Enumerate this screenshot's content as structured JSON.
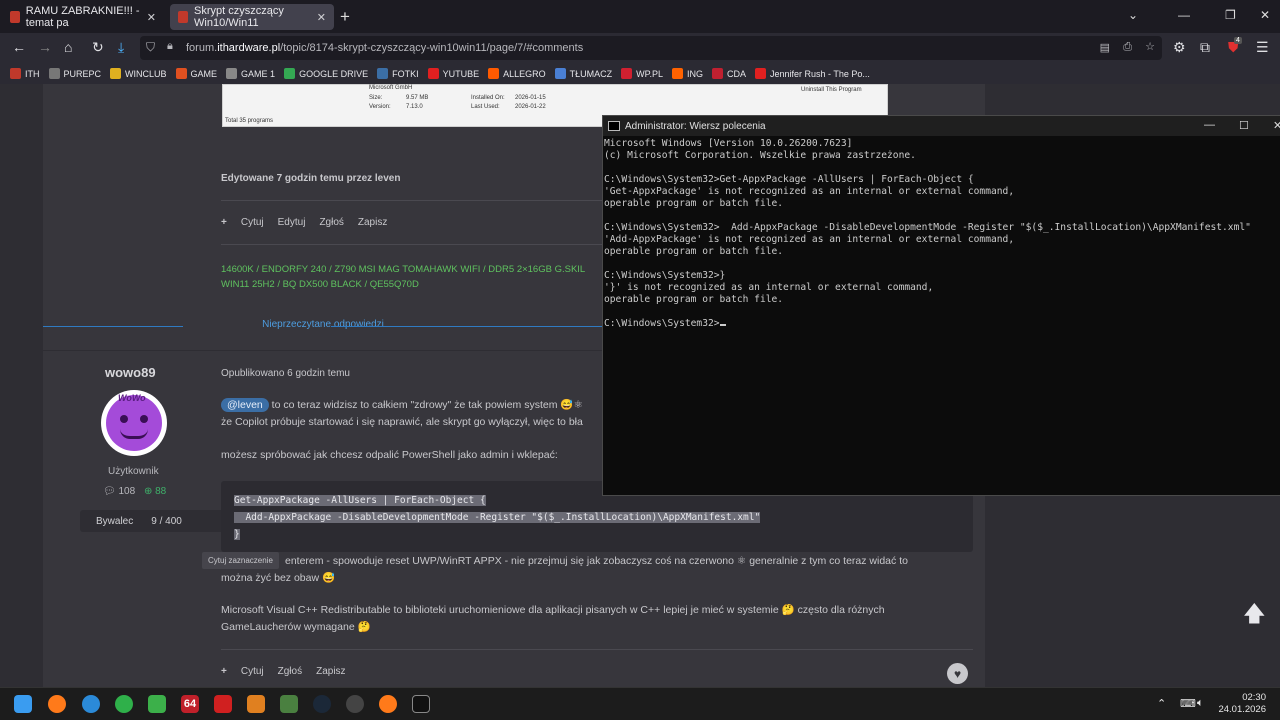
{
  "browser": {
    "tabs": [
      {
        "title": "RAMU ZABRAKNIE!!! - temat pa",
        "active": false
      },
      {
        "title": "Skrypt czyszczący Win10/Win11",
        "active": true
      }
    ],
    "url_prefix": "forum.",
    "url_domain": "ithardware.pl",
    "url_path": "/topic/8174-skrypt-czyszczący-win10win11/page/7/#comments",
    "bookmarks": [
      {
        "label": "ITH",
        "color": "#c0392b"
      },
      {
        "label": "PUREPC",
        "color": "#777777"
      },
      {
        "label": "WINCLUB",
        "color": "#e0b020"
      },
      {
        "label": "GAME",
        "color": "#e05020"
      },
      {
        "label": "GAME 1",
        "color": "#888888"
      },
      {
        "label": "GOOGLE DRIVE",
        "color": "#34a853"
      },
      {
        "label": "FOTKI",
        "color": "#3b6ea5"
      },
      {
        "label": "YUTUBE",
        "color": "#e02020"
      },
      {
        "label": "ALLEGRO",
        "color": "#ff5a00"
      },
      {
        "label": "TŁUMACZ",
        "color": "#4a7fd4"
      },
      {
        "label": "WP.PL",
        "color": "#d02030"
      },
      {
        "label": "ING",
        "color": "#ff6200"
      },
      {
        "label": "CDA",
        "color": "#c02030"
      },
      {
        "label": "Jennifer Rush - The Po...",
        "color": "#e02020"
      }
    ],
    "extension_badge": "4"
  },
  "prev_post": {
    "screenshot": {
      "app_name": "Microsoft GmbH",
      "size_label": "Size:",
      "size_value": "9.57 MB",
      "version_label": "Version:",
      "version_value": "7.13.0",
      "installed_label": "Installed On:",
      "installed_value": "2026-01-15",
      "used_label": "Last Used:",
      "used_value": "2026-01-22",
      "uninstall": "Uninstall This Program",
      "total": "Total 35 programs"
    },
    "edited": "Edytowane 7 godzin temu przez leven",
    "actions": [
      "Cytuj",
      "Edytuj",
      "Zgłoś",
      "Zapisz"
    ],
    "signature_line1": "14600K / ENDORFY 240 / Z790 MSI MAG TOMAHAWK WIFI / DDR5 2×16GB G.SKIL",
    "signature_line2": "WIN11 25H2 / BQ DX500 BLACK / QE55Q70D"
  },
  "divider_label": "Nieprzeczytane odpowiedzi",
  "post": {
    "username": "wowo89",
    "avatar_text": "WoWo",
    "role": "Użytkownik",
    "posts_count": "108",
    "reputation": "88",
    "rank": "Bywalec",
    "rank_progress": "9 / 400",
    "posted": "Opublikowano 6 godzin temu",
    "mention": "@leven",
    "line1": " to co teraz widzisz to całkiem \"zdrowy\" że tak powiem system 😅⚛",
    "line2": "że Copilot próbuje startować i się naprawić, ale skrypt go wyłączył, więc to bła",
    "line3": "możesz spróbować jak chcesz odpalić PowerShell jako admin i wklepać:",
    "code1": "Get-AppxPackage -AllUsers | ForEach-Object {",
    "code2": "  Add-AppxPackage -DisableDevelopmentMode -Register \"$($_.InstallLocation)\\AppXManifest.xml\"",
    "code3": "}",
    "quote_tip": "Cytuj zaznaczenie",
    "line4a": "enterem - spowoduje reset UWP/WinRT APPX - nie przejmuj się jak zobaczysz coś na czerwono ⚛ generalnie z tym co teraz widać to",
    "line4b": "można żyć bez obaw 😅",
    "line5a": "Microsoft Visual C++ Redistributable to biblioteki uruchomieniowe dla aplikacji pisanych w C++ lepiej je mieć w systemie 🤔 często dla różnych",
    "line5b": "GameLaucherów wymagane 🤔",
    "actions": [
      "Cytuj",
      "Zgłoś",
      "Zapisz"
    ]
  },
  "cmd": {
    "title": "Administrator: Wiersz polecenia",
    "lines": [
      "Microsoft Windows [Version 10.0.26200.7623]",
      "(c) Microsoft Corporation. Wszelkie prawa zastrzeżone.",
      "",
      "C:\\Windows\\System32>Get-AppxPackage -AllUsers | ForEach-Object {",
      "'Get-AppxPackage' is not recognized as an internal or external command,",
      "operable program or batch file.",
      "",
      "C:\\Windows\\System32>  Add-AppxPackage -DisableDevelopmentMode -Register \"$($_.InstallLocation)\\AppXManifest.xml\"",
      "'Add-AppxPackage' is not recognized as an internal or external command,",
      "operable program or batch file.",
      "",
      "C:\\Windows\\System32>}",
      "'}' is not recognized as an internal or external command,",
      "operable program or batch file.",
      ""
    ],
    "prompt": "C:\\Windows\\System32>"
  },
  "taskbar": {
    "time": "02:30",
    "date": "24.01.2026",
    "app_64_label": "64"
  }
}
